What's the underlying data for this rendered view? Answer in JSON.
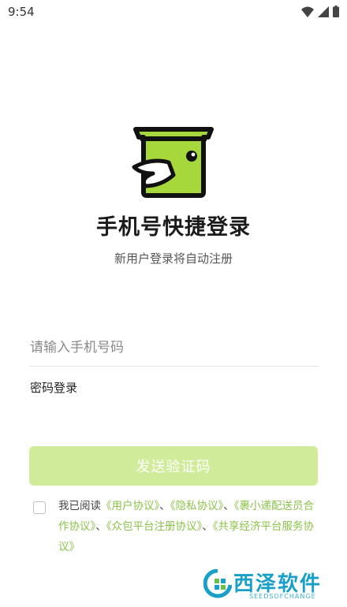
{
  "status_bar": {
    "time": "9:54"
  },
  "header": {
    "title": "手机号快捷登录",
    "subtitle": "新用户登录将自动注册"
  },
  "form": {
    "phone_placeholder": "请输入手机号码",
    "password_login_label": "密码登录",
    "send_code_label": "发送验证码"
  },
  "agreement": {
    "prefix": "我已阅读",
    "links": [
      "《用户协议》",
      "《隐私协议》",
      "《裹小递配送员合作协议》",
      "《众包平台注册协议》",
      "《共享经济平台服务协议》"
    ],
    "separator": "、"
  },
  "watermark": {
    "name": "西泽软件",
    "sub": "SEEDSOFCHANGE"
  },
  "colors": {
    "accent": "#8bc34a",
    "button_bg": "#d0ec9a",
    "logo_green": "#a6d83c"
  }
}
